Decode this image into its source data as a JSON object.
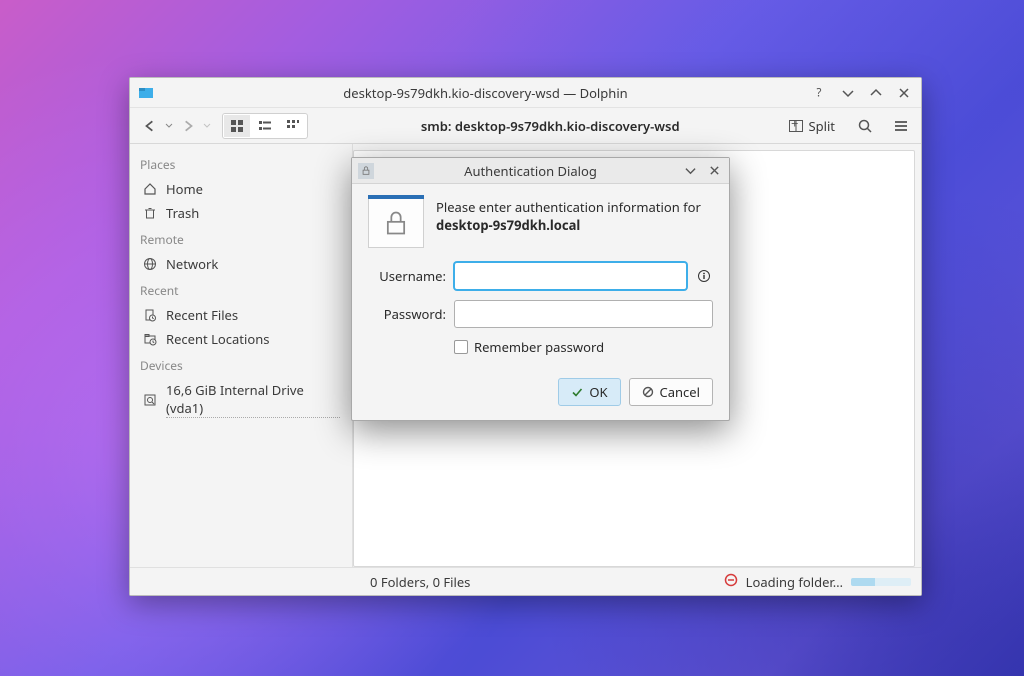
{
  "window": {
    "title": "desktop-9s79dkh.kio-discovery-wsd — Dolphin",
    "breadcrumb": "smb: desktop-9s79dkh.kio-discovery-wsd",
    "split_label": "Split"
  },
  "sidebar": {
    "places_label": "Places",
    "home": "Home",
    "trash": "Trash",
    "remote_label": "Remote",
    "network": "Network",
    "recent_label": "Recent",
    "recent_files": "Recent Files",
    "recent_locations": "Recent Locations",
    "devices_label": "Devices",
    "drive": "16,6 GiB Internal Drive (vda1)"
  },
  "statusbar": {
    "left": "0 Folders, 0 Files",
    "right": "Loading folder…"
  },
  "dialog": {
    "title": "Authentication Dialog",
    "message_prefix": "Please enter authentication information for",
    "host": "desktop-9s79dkh.local",
    "username_label": "Username:",
    "password_label": "Password:",
    "remember_label": "Remember password",
    "ok_label": "OK",
    "cancel_label": "Cancel",
    "username_value": "",
    "password_value": ""
  }
}
